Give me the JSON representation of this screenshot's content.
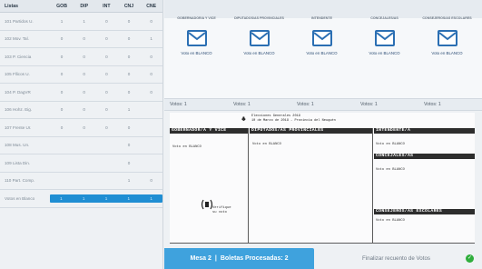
{
  "table": {
    "headers": [
      "Listas",
      "GOB",
      "DIP",
      "INT",
      "CNJ",
      "CNE"
    ],
    "rows": [
      {
        "name": "101 Partidos U.",
        "cells": [
          "1",
          "1",
          "0",
          "0",
          "0"
        ]
      },
      {
        "name": "102 Mov. Tal.",
        "cells": [
          "0",
          "0",
          "0",
          "0",
          "1"
        ]
      },
      {
        "name": "103 P. Ciencia",
        "cells": [
          "0",
          "0",
          "0",
          "0",
          "0"
        ]
      },
      {
        "name": "105 Fllicos U.",
        "cells": [
          "0",
          "0",
          "0",
          "0",
          "0"
        ]
      },
      {
        "name": "104 P. DagVR",
        "cells": [
          "0",
          "0",
          "0",
          "0",
          "0"
        ]
      },
      {
        "name": "106 Hohz. Eig.",
        "cells": [
          "0",
          "0",
          "0",
          "1",
          ""
        ]
      },
      {
        "name": "107 Frente Ur.",
        "cells": [
          "0",
          "0",
          "0",
          "0",
          ""
        ]
      },
      {
        "name": "108 Mus. Un.",
        "cells": [
          "",
          "",
          "",
          "0",
          ""
        ]
      },
      {
        "name": "109 Lista Din.",
        "cells": [
          "",
          "",
          "",
          "0",
          ""
        ]
      },
      {
        "name": "110 Part. Comp.",
        "cells": [
          "",
          "",
          "",
          "1",
          "0"
        ]
      }
    ],
    "blank": {
      "name": "Votos en Blanco",
      "cells": [
        "1",
        "1",
        "1",
        "1",
        "1"
      ]
    }
  },
  "cards": [
    {
      "title": "GOBERNADOR/A Y VICE",
      "blank": "Voto en BLANCO"
    },
    {
      "title": "DIPUTADOS/AS PROVINCIALES",
      "blank": "Voto en BLANCO"
    },
    {
      "title": "INTENDENTE",
      "blank": "Voto en BLANCO"
    },
    {
      "title": "CONCEJALES/AS",
      "blank": "Voto en BLANCO"
    },
    {
      "title": "CONSEJEROS/AS ESCOLARES",
      "blank": "Voto en BLANCO"
    }
  ],
  "votes": [
    "Votos: 1",
    "Votos: 1",
    "Votos: 1",
    "Votos: 1",
    "Votos: 1"
  ],
  "ballot": {
    "head1": "Elecciones Generales 2019",
    "head2": "10 de Marzo de 2019 - Provincia del Neuquén",
    "gob": "GOBERNADOR/A Y VICE",
    "dip": "DIPUTADOS/AS PROVINCIALES",
    "int": "INTENDENTE/A",
    "conc": "CONCEJALES/AS",
    "cons": "CONSEJEROS/AS ESCOLARES",
    "blank": "Voto en BLANCO",
    "chip": "Verifique\nsu voto"
  },
  "footer": {
    "mesa": "Mesa 2",
    "boletas": "Boletas Procesadas: 2",
    "finish": "Finalizar recuento de Votos"
  },
  "colors": {
    "accent": "#3fa2dd",
    "envelope": "#2b6fb3",
    "ok": "#2fae3c"
  }
}
